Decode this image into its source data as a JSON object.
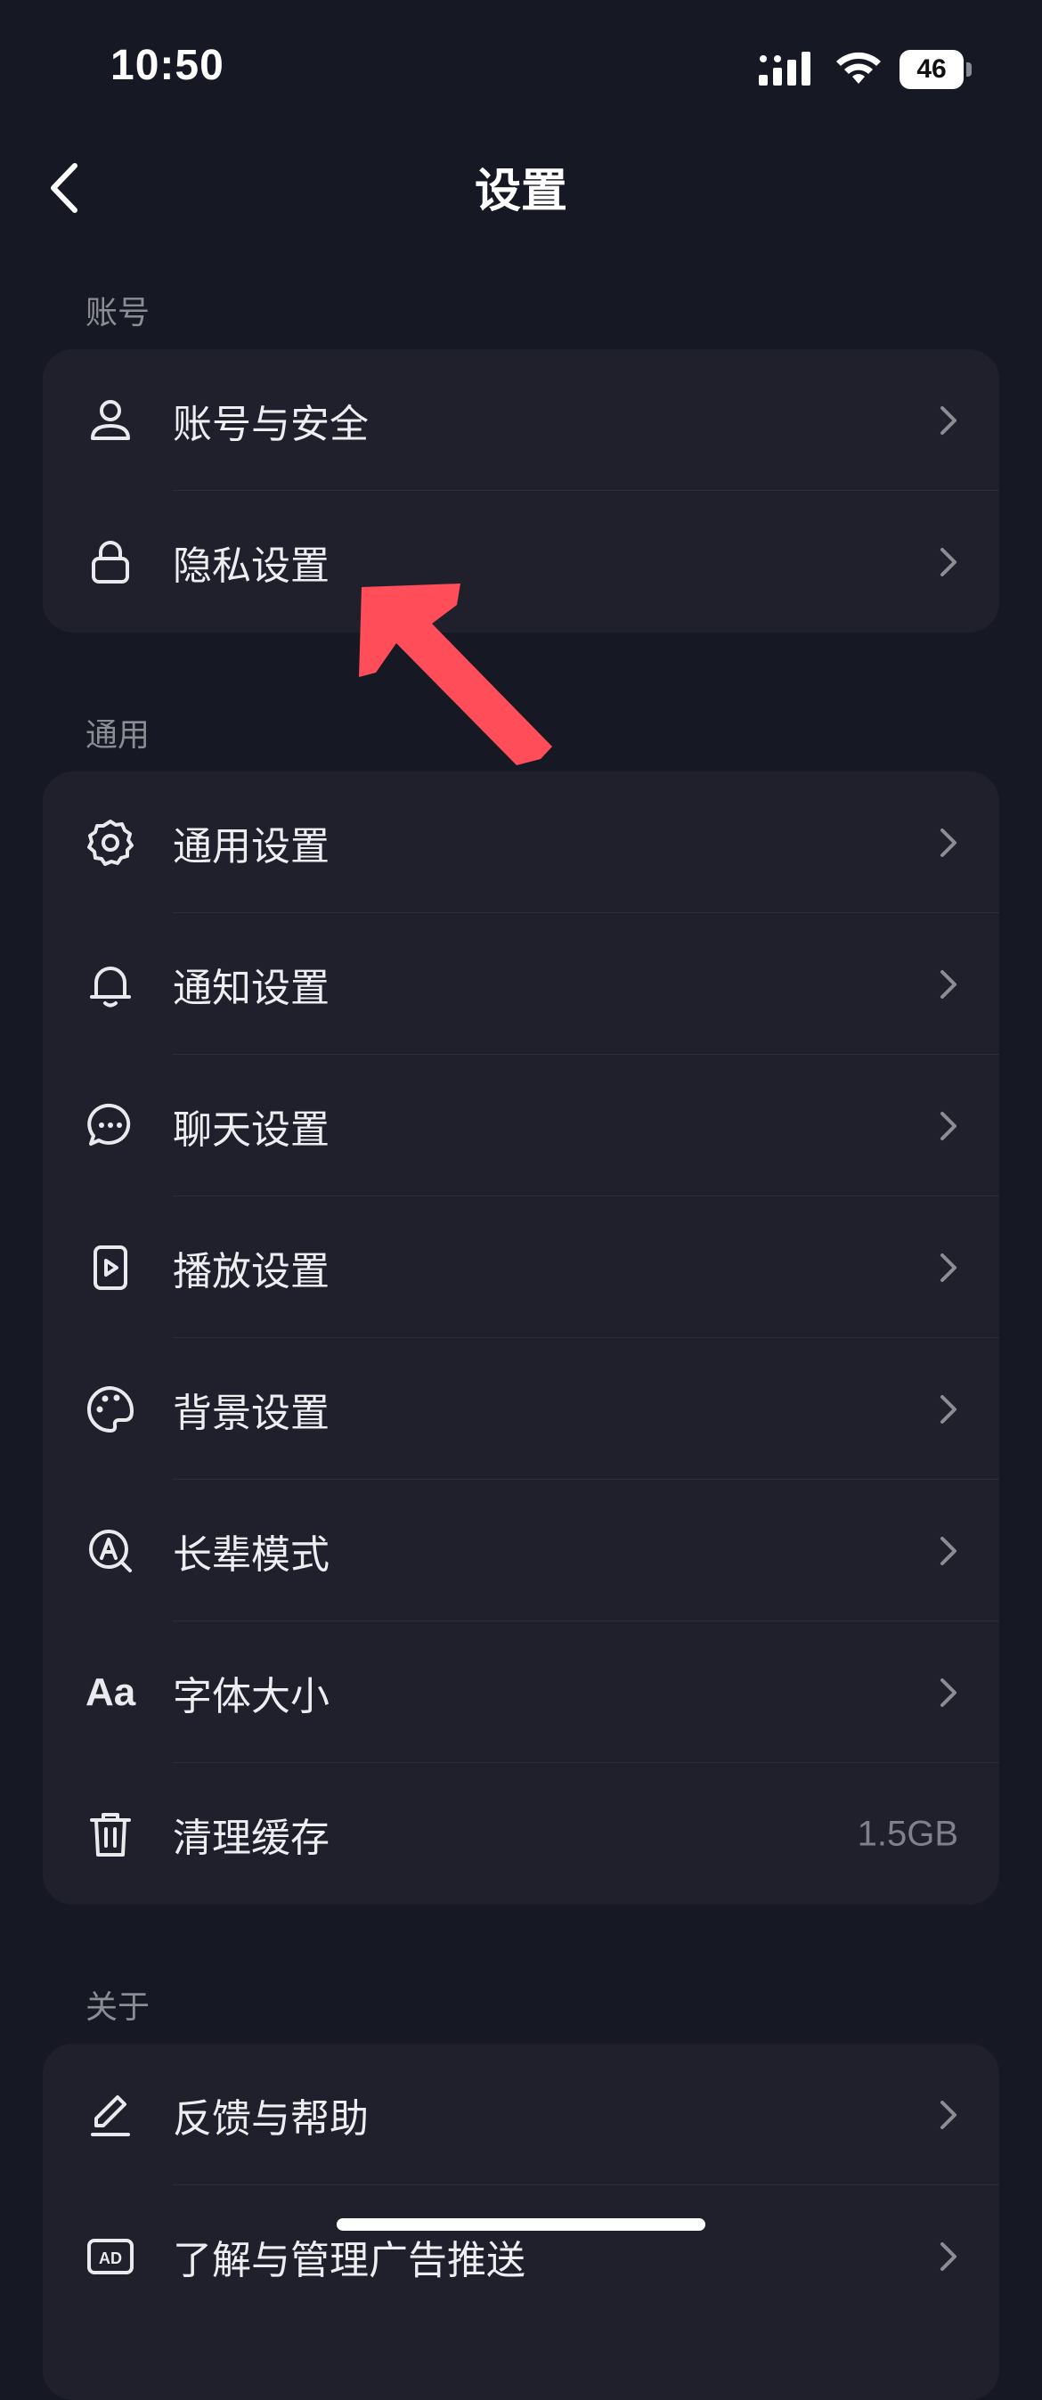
{
  "status_bar": {
    "time": "10:50",
    "battery": "46"
  },
  "header": {
    "title": "设置"
  },
  "sections": {
    "account": {
      "label": "账号",
      "items": [
        {
          "label": "账号与安全",
          "icon": "user-icon"
        },
        {
          "label": "隐私设置",
          "icon": "lock-icon"
        }
      ]
    },
    "general": {
      "label": "通用",
      "items": [
        {
          "label": "通用设置",
          "icon": "gear-icon"
        },
        {
          "label": "通知设置",
          "icon": "bell-icon"
        },
        {
          "label": "聊天设置",
          "icon": "chat-bubble-icon"
        },
        {
          "label": "播放设置",
          "icon": "play-icon"
        },
        {
          "label": "背景设置",
          "icon": "palette-icon"
        },
        {
          "label": "长辈模式",
          "icon": "elder-mode-icon"
        },
        {
          "label": "字体大小",
          "icon": "font-size-icon",
          "icon_text": "Aa"
        },
        {
          "label": "清理缓存",
          "icon": "trash-icon",
          "value": "1.5GB"
        }
      ]
    },
    "about": {
      "label": "关于",
      "items": [
        {
          "label": "反馈与帮助",
          "icon": "edit-icon"
        },
        {
          "label": "了解与管理广告推送",
          "icon": "ad-icon"
        }
      ]
    }
  },
  "annotation": {
    "color": "#ff4d5a"
  }
}
